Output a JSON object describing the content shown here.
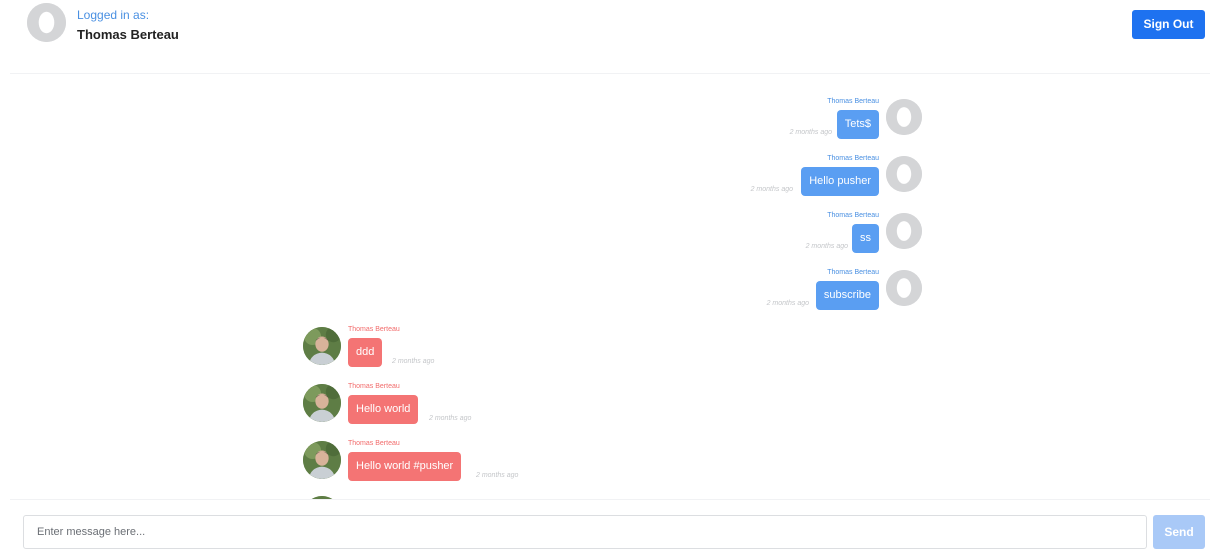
{
  "header": {
    "logged_label": "Logged in as:",
    "user_name": "Thomas Berteau",
    "signout_label": "Sign Out"
  },
  "messages": [
    {
      "direction": "out",
      "sender": "Thomas Berteau",
      "text": "Tets$",
      "time": "2 months ago",
      "avatar": "user-placeholder-icon"
    },
    {
      "direction": "out",
      "sender": "Thomas Berteau",
      "text": "Hello pusher",
      "time": "2 months ago",
      "avatar": "user-placeholder-icon"
    },
    {
      "direction": "out",
      "sender": "Thomas Berteau",
      "text": "ss",
      "time": "2 months ago",
      "avatar": "user-placeholder-icon"
    },
    {
      "direction": "out",
      "sender": "Thomas Berteau",
      "text": "subscribe",
      "time": "2 months ago",
      "avatar": "user-placeholder-icon"
    },
    {
      "direction": "in",
      "sender": "Thomas Berteau",
      "text": "ddd",
      "time": "2 months ago",
      "avatar": "user-photo"
    },
    {
      "direction": "in",
      "sender": "Thomas Berteau",
      "text": "Hello world",
      "time": "2 months ago",
      "avatar": "user-photo"
    },
    {
      "direction": "in",
      "sender": "Thomas Berteau",
      "text": "Hello world #pusher",
      "time": "2 months ago",
      "avatar": "user-photo"
    }
  ],
  "composer": {
    "placeholder": "Enter message here...",
    "value": "",
    "send_label": "Send"
  },
  "colors": {
    "accent": "#1e72f0",
    "outgoing_bubble": "#5a9ef2",
    "incoming_bubble": "#f47474",
    "send_disabled": "#a9c9f7"
  }
}
